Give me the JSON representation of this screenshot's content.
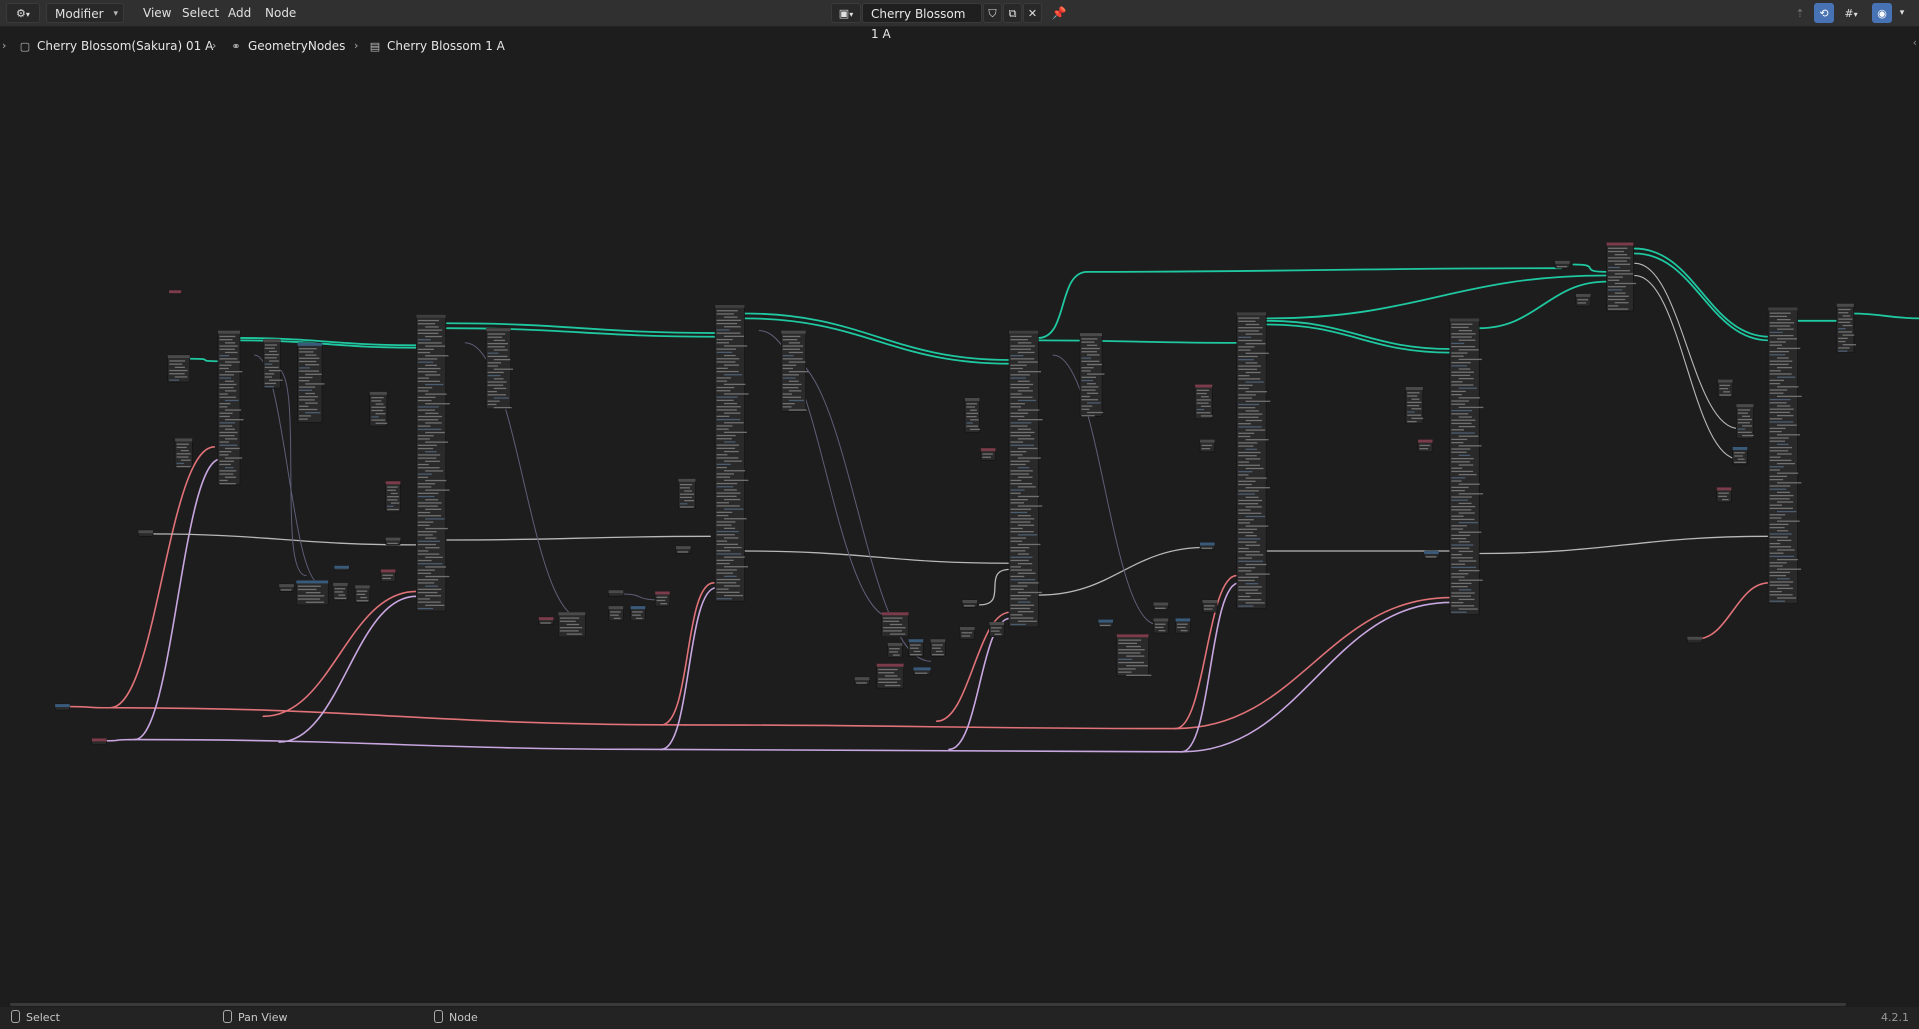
{
  "header": {
    "editor_type_icon": "node-editor-icon",
    "mode_dropdown": "Modifier",
    "menus": [
      "View",
      "Select",
      "Add",
      "Node"
    ],
    "node_tree_icon": "geometry-nodes-icon",
    "node_tree_name": "Cherry Blossom 1 A",
    "fake_user_icon": "shield-icon",
    "duplicate_icon": "duplicate-icon",
    "unlink_icon": "close-icon",
    "pin_icon": "pin-icon",
    "right_icons": [
      "parent-icon",
      "snap-icon",
      "overlay-icon",
      "gizmo-icon"
    ]
  },
  "breadcrumb": {
    "items": [
      {
        "label": "Cherry Blossom(Sakura) 01 A",
        "icon": "object-icon"
      },
      {
        "label": "GeometryNodes",
        "icon": "modifier-icon"
      },
      {
        "label": "Cherry Blossom 1 A",
        "icon": "node-tree-icon"
      }
    ]
  },
  "status": {
    "select": "Select",
    "pan": "Pan View",
    "node": "Node",
    "version": "4.2.1"
  },
  "colors": {
    "geometry_link": "#1fc8a0",
    "float_link": "#e07278",
    "vector_link": "#c8a6e0",
    "gray_link": "#b8b8b8",
    "dark_link": "#5e5e78"
  }
}
